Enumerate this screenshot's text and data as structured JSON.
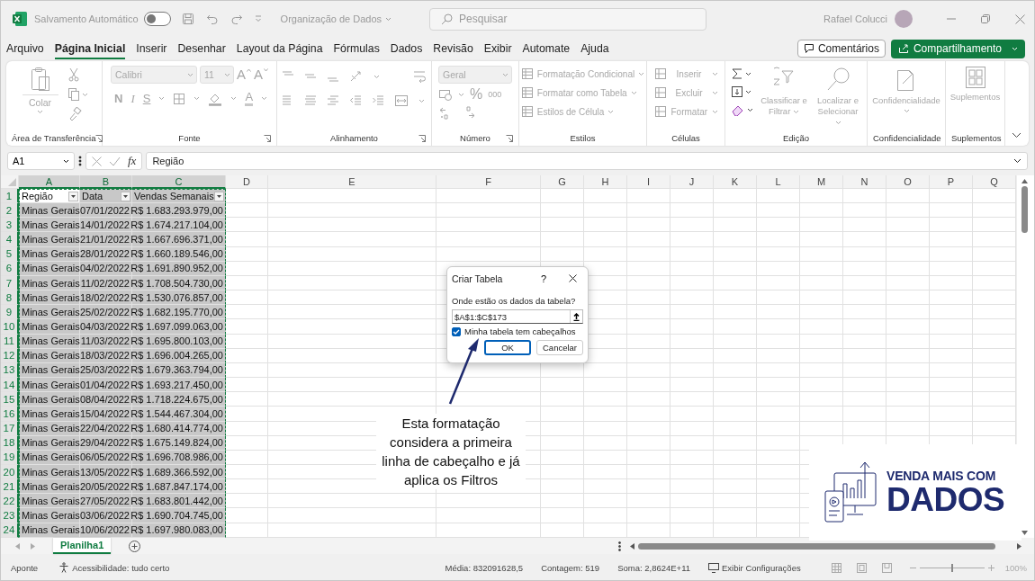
{
  "title_bar": {
    "autosave_label": "Salvamento Automático",
    "autosave_on": false,
    "document_title": "Organização de Dados",
    "search_placeholder": "Pesquisar",
    "user_name": "Rafael Colucci"
  },
  "ribbon_tabs": [
    {
      "label": "Arquivo",
      "selected": false
    },
    {
      "label": "Página Inicial",
      "selected": true
    },
    {
      "label": "Inserir",
      "selected": false
    },
    {
      "label": "Desenhar",
      "selected": false
    },
    {
      "label": "Layout da Página",
      "selected": false
    },
    {
      "label": "Fórmulas",
      "selected": false
    },
    {
      "label": "Dados",
      "selected": false
    },
    {
      "label": "Revisão",
      "selected": false
    },
    {
      "label": "Exibir",
      "selected": false
    },
    {
      "label": "Automate",
      "selected": false
    },
    {
      "label": "Ajuda",
      "selected": false
    }
  ],
  "ribbon_actions": {
    "comments": "Comentários",
    "share": "Compartilhamento"
  },
  "ribbon_groups": [
    {
      "kind": "clipboard",
      "label": "Área de Transferência",
      "disabled": true,
      "paste": "Colar"
    },
    {
      "kind": "font",
      "label": "Fonte",
      "disabled": true,
      "font_name": "Calibri",
      "font_size": "11",
      "grow": "A",
      "shrink": "A",
      "bold": "N",
      "italic": "I",
      "underline": "S",
      "font_color": "A"
    },
    {
      "kind": "alignment",
      "label": "Alinhamento",
      "disabled": true
    },
    {
      "kind": "number",
      "label": "Número",
      "disabled": true,
      "format": "Geral",
      "percent": "%",
      "thousands": "000"
    },
    {
      "kind": "styles",
      "label": "Estilos",
      "disabled": true,
      "items": [
        "Formatação Condicional",
        "Formatar como Tabela",
        "Estilos de Célula"
      ]
    },
    {
      "kind": "cells",
      "label": "Células",
      "disabled": true,
      "items": [
        "Inserir",
        "Excluir",
        "Formatar"
      ]
    },
    {
      "kind": "editing",
      "label": "Edição",
      "disabled": false,
      "items": [
        {
          "label": "Classificar e Filtrar",
          "disabled": true
        },
        {
          "label": "Localizar e Selecionar",
          "disabled": true
        }
      ]
    },
    {
      "kind": "sensitivity",
      "label": "Confidencialidade",
      "disabled": true,
      "button": "Confidencialidade"
    },
    {
      "kind": "addins",
      "label": "Suplementos",
      "disabled": true,
      "button": "Suplementos"
    }
  ],
  "formula_bar": {
    "name_box": "A1",
    "fx": "fx",
    "formula": "Região"
  },
  "sheet": {
    "columns": [
      {
        "label": "A",
        "selected": true,
        "active": true
      },
      {
        "label": "B",
        "selected": true
      },
      {
        "label": "C",
        "selected": true
      },
      {
        "label": "D",
        "selected": false
      },
      {
        "label": "E",
        "selected": false
      },
      {
        "label": "F",
        "selected": false
      },
      {
        "label": "G",
        "selected": false
      },
      {
        "label": "H",
        "selected": false
      },
      {
        "label": "I",
        "selected": false
      },
      {
        "label": "J",
        "selected": false
      },
      {
        "label": "K",
        "selected": false
      },
      {
        "label": "L",
        "selected": false
      },
      {
        "label": "M",
        "selected": false
      },
      {
        "label": "N",
        "selected": false
      },
      {
        "label": "O",
        "selected": false
      },
      {
        "label": "P",
        "selected": false
      },
      {
        "label": "Q",
        "selected": false
      }
    ],
    "rows": [
      {
        "header": "1",
        "selected": true,
        "active": true,
        "kind": "header",
        "cells": [
          "Região",
          "Data",
          "Vendas Semanais"
        ]
      },
      {
        "header": "2",
        "selected": true,
        "kind": "data",
        "cells": [
          "Minas Gerais",
          "07/01/2022",
          "R$ 1.683.293.979,00"
        ]
      },
      {
        "header": "3",
        "selected": true,
        "kind": "data",
        "cells": [
          "Minas Gerais",
          "14/01/2022",
          "R$ 1.674.217.104,00"
        ]
      },
      {
        "header": "4",
        "selected": true,
        "kind": "data",
        "cells": [
          "Minas Gerais",
          "21/01/2022",
          "R$ 1.667.696.371,00"
        ]
      },
      {
        "header": "5",
        "selected": true,
        "kind": "data",
        "cells": [
          "Minas Gerais",
          "28/01/2022",
          "R$ 1.660.189.546,00"
        ]
      },
      {
        "header": "6",
        "selected": true,
        "kind": "data",
        "cells": [
          "Minas Gerais",
          "04/02/2022",
          "R$ 1.691.890.952,00"
        ]
      },
      {
        "header": "7",
        "selected": true,
        "kind": "data",
        "cells": [
          "Minas Gerais",
          "11/02/2022",
          "R$ 1.708.504.730,00"
        ]
      },
      {
        "header": "8",
        "selected": true,
        "kind": "data",
        "cells": [
          "Minas Gerais",
          "18/02/2022",
          "R$ 1.530.076.857,00"
        ]
      },
      {
        "header": "9",
        "selected": true,
        "kind": "data",
        "cells": [
          "Minas Gerais",
          "25/02/2022",
          "R$ 1.682.195.770,00"
        ]
      },
      {
        "header": "10",
        "selected": true,
        "kind": "data",
        "cells": [
          "Minas Gerais",
          "04/03/2022",
          "R$ 1.697.099.063,00"
        ]
      },
      {
        "header": "11",
        "selected": true,
        "kind": "data",
        "cells": [
          "Minas Gerais",
          "11/03/2022",
          "R$ 1.695.800.103,00"
        ]
      },
      {
        "header": "12",
        "selected": true,
        "kind": "data",
        "cells": [
          "Minas Gerais",
          "18/03/2022",
          "R$ 1.696.004.265,00"
        ]
      },
      {
        "header": "13",
        "selected": true,
        "kind": "data",
        "cells": [
          "Minas Gerais",
          "25/03/2022",
          "R$ 1.679.363.794,00"
        ]
      },
      {
        "header": "14",
        "selected": true,
        "kind": "data",
        "cells": [
          "Minas Gerais",
          "01/04/2022",
          "R$ 1.693.217.450,00"
        ]
      },
      {
        "header": "15",
        "selected": true,
        "kind": "data",
        "cells": [
          "Minas Gerais",
          "08/04/2022",
          "R$ 1.718.224.675,00"
        ]
      },
      {
        "header": "16",
        "selected": true,
        "kind": "data",
        "cells": [
          "Minas Gerais",
          "15/04/2022",
          "R$ 1.544.467.304,00"
        ]
      },
      {
        "header": "17",
        "selected": true,
        "kind": "data",
        "cells": [
          "Minas Gerais",
          "22/04/2022",
          "R$ 1.680.414.774,00"
        ]
      },
      {
        "header": "18",
        "selected": true,
        "kind": "data",
        "cells": [
          "Minas Gerais",
          "29/04/2022",
          "R$ 1.675.149.824,00"
        ]
      },
      {
        "header": "19",
        "selected": true,
        "kind": "data",
        "cells": [
          "Minas Gerais",
          "06/05/2022",
          "R$ 1.696.708.986,00"
        ]
      },
      {
        "header": "20",
        "selected": true,
        "kind": "data",
        "cells": [
          "Minas Gerais",
          "13/05/2022",
          "R$ 1.689.366.592,00"
        ]
      },
      {
        "header": "21",
        "selected": true,
        "kind": "data",
        "cells": [
          "Minas Gerais",
          "20/05/2022",
          "R$ 1.687.847.174,00"
        ]
      },
      {
        "header": "22",
        "selected": true,
        "kind": "data",
        "cells": [
          "Minas Gerais",
          "27/05/2022",
          "R$ 1.683.801.442,00"
        ]
      },
      {
        "header": "23",
        "selected": true,
        "kind": "data",
        "cells": [
          "Minas Gerais",
          "03/06/2022",
          "R$ 1.690.704.745,00"
        ]
      },
      {
        "header": "24",
        "selected": true,
        "kind": "data",
        "cells": [
          "Minas Gerais",
          "10/06/2022",
          "R$ 1.697.980.083,00"
        ]
      }
    ]
  },
  "dialog": {
    "title": "Criar Tabela",
    "help": "?",
    "prompt": "Onde estão os dados da tabela?",
    "range": "$A$1:$C$173",
    "has_headers_label": "Minha tabela tem cabeçalhos",
    "has_headers": true,
    "ok": "OK",
    "cancel": "Cancelar"
  },
  "annotation": "Esta formatação considera a primeira linha de cabeçalho e já aplica os Filtros",
  "logo": {
    "line1": "VENDA MAIS COM",
    "line2": "DADOS"
  },
  "sheet_tabs": [
    {
      "label": "Planilha1",
      "selected": true
    }
  ],
  "status_bar": {
    "mode": "Aponte",
    "accessibility": "Acessibilidade: tudo certo",
    "average": "Média: 832091628,5",
    "count": "Contagem: 519",
    "sum": "Soma: 2,8624E+11",
    "display_settings": "Exibir Configurações",
    "zoom": {
      "label": "100%",
      "level": 0.5
    }
  }
}
